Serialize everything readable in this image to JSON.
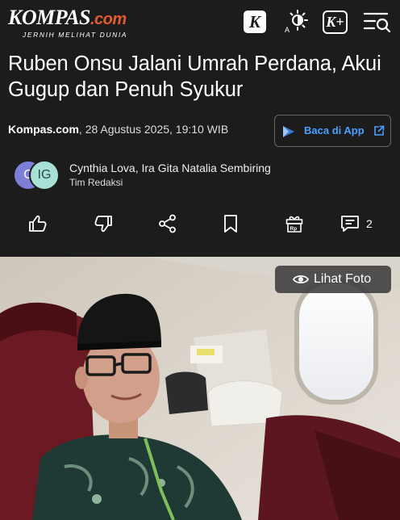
{
  "header": {
    "logo_main": "KOMPAS",
    "logo_suffix": ".com",
    "logo_tagline": "JERNIH MELIHAT DUNIA",
    "k_label": "K",
    "theme_label": "A",
    "kplus_label": "K+"
  },
  "article": {
    "title": "Ruben Onsu Jalani Umrah Perdana, Akui Gugup dan Penuh Syukur",
    "source": "Kompas.com",
    "date": ", 28 Agustus 2025, 19:10 WIB",
    "app_button": "Baca di App",
    "authors": "Cynthia Lova,  Ira Gita Natalia Sembiring",
    "team": "Tim Redaksi",
    "avatar1": "C",
    "avatar2": "IG",
    "comment_count": "2",
    "photo_button": "Lihat Foto"
  },
  "colors": {
    "background": "#1c1c1c",
    "accent_blue": "#4aa0ff",
    "logo_dot": "#e35a2b"
  },
  "icons": [
    "k-logo-icon",
    "brightness-icon",
    "kplus-icon",
    "menu-search-icon",
    "like-icon",
    "dislike-icon",
    "share-icon",
    "bookmark-icon",
    "gift-icon",
    "comment-icon",
    "eye-icon",
    "external-link-icon"
  ]
}
